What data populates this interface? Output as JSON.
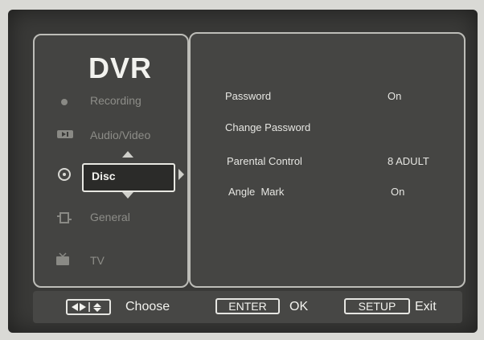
{
  "brand": "DVR",
  "menu": {
    "items": [
      {
        "label": "Recording",
        "icon": "record-icon"
      },
      {
        "label": "Audio/Video",
        "icon": "audio-video-icon"
      },
      {
        "label": "Disc",
        "icon": "disc-icon",
        "selected": true
      },
      {
        "label": "General",
        "icon": "general-icon"
      },
      {
        "label": "TV",
        "icon": "tv-icon"
      }
    ]
  },
  "settings": [
    {
      "label": "Password",
      "value": "On"
    },
    {
      "label": "Change Password",
      "value": ""
    },
    {
      "label": "Parental Control",
      "value": "8 ADULT"
    },
    {
      "label": "Angle  Mark",
      "value": "On"
    }
  ],
  "footer": {
    "choose_label": "Choose",
    "enter_key": "ENTER",
    "ok_label": "OK",
    "setup_key": "SETUP",
    "exit_label": "Exit"
  }
}
